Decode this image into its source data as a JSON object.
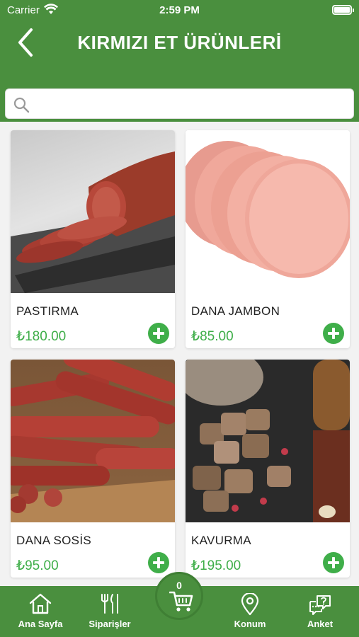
{
  "status_bar": {
    "carrier": "Carrier",
    "time": "2:59 PM"
  },
  "header": {
    "title": "KIRMIZI ET ÜRÜNLERİ"
  },
  "search": {
    "placeholder": ""
  },
  "products": [
    {
      "name": "PASTIRMA",
      "price": "₺180.00"
    },
    {
      "name": "DANA JAMBON",
      "price": "₺85.00"
    },
    {
      "name": "DANA SOSİS",
      "price": "₺95.00"
    },
    {
      "name": "KAVURMA",
      "price": "₺195.00"
    }
  ],
  "tabbar": {
    "home": "Ana Sayfa",
    "orders": "Siparişler",
    "cart_count": "0",
    "location": "Konum",
    "survey": "Anket"
  },
  "colors": {
    "brand_green": "#4a8f3e",
    "price_green": "#3fae49"
  }
}
